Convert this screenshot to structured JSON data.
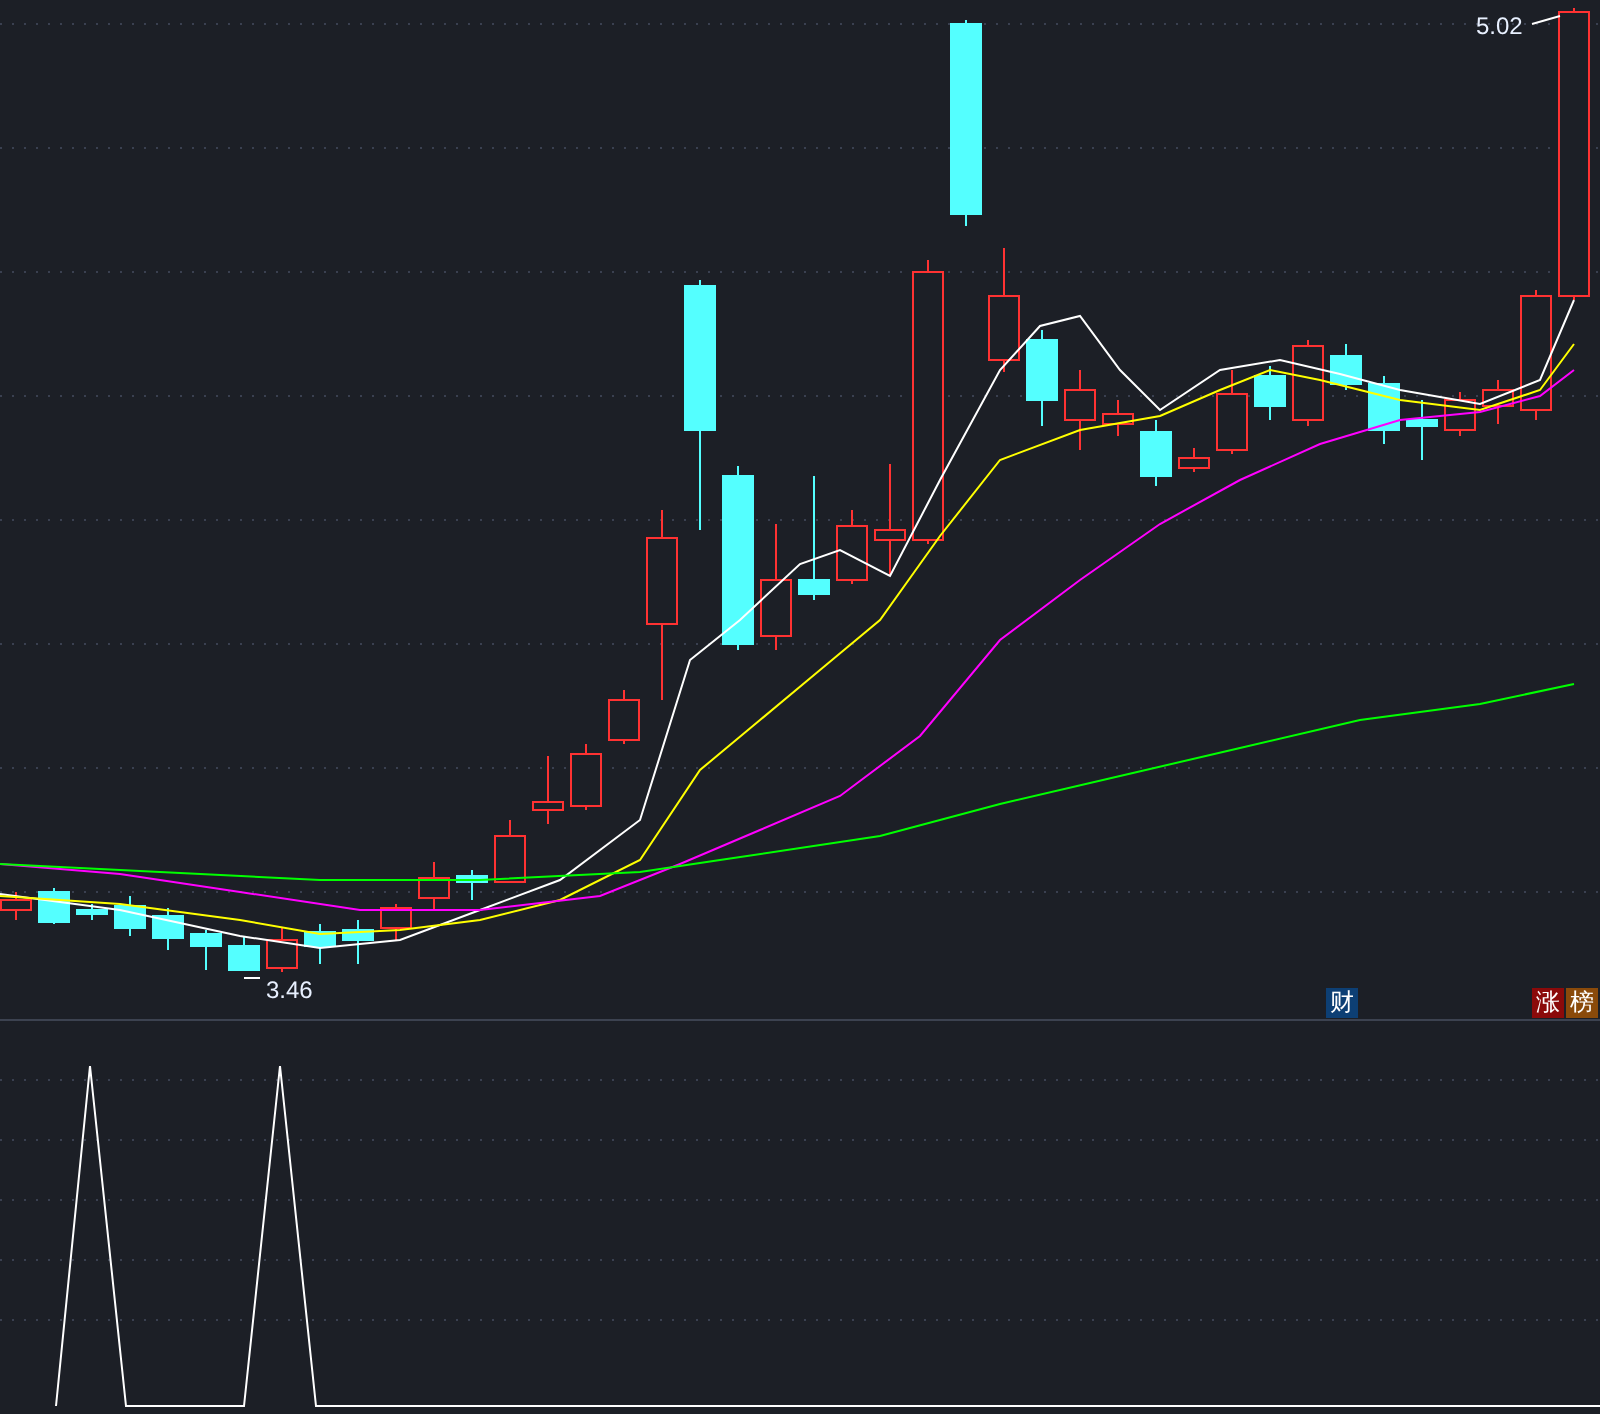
{
  "main_chart": {
    "high_label": "5.02",
    "low_label": "3.46"
  },
  "badges": [
    {
      "text": "财",
      "color": "#0d3f74"
    },
    {
      "text": "涨",
      "color": "#8b0a0a"
    },
    {
      "text": "榜",
      "color": "#8a4a0a"
    }
  ]
}
